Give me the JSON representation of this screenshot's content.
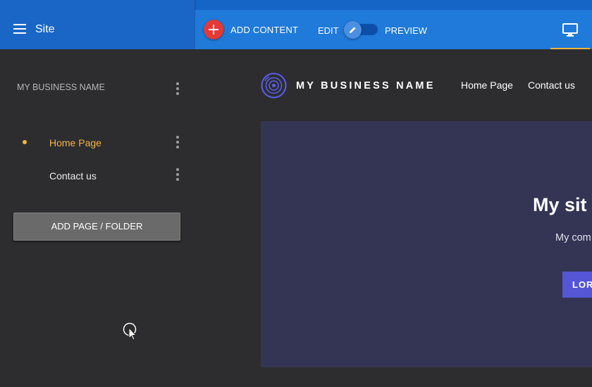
{
  "header": {
    "site_title": "Site",
    "add_content_label": "ADD CONTENT",
    "edit_label": "EDIT",
    "preview_label": "PREVIEW",
    "device_icon": "desktop-icon",
    "colors": {
      "bar": "#1c6fd0",
      "accent": "#f4b43f",
      "add_button": "#e53935"
    }
  },
  "sidebar": {
    "site_name": "MY BUSINESS NAME",
    "pages": [
      {
        "label": "Home Page",
        "active": true
      },
      {
        "label": "Contact us",
        "active": false
      }
    ],
    "add_page_label": "ADD PAGE / FOLDER"
  },
  "preview": {
    "brand": "MY BUSINESS NAME",
    "nav": [
      "Home Page",
      "Contact us"
    ],
    "hero_title": "My sit",
    "hero_subtitle": "My com",
    "hero_button": "LOR",
    "colors": {
      "hero_bg": "#343555",
      "hero_button": "#5456d6",
      "logo": "#5b5ef0"
    }
  }
}
